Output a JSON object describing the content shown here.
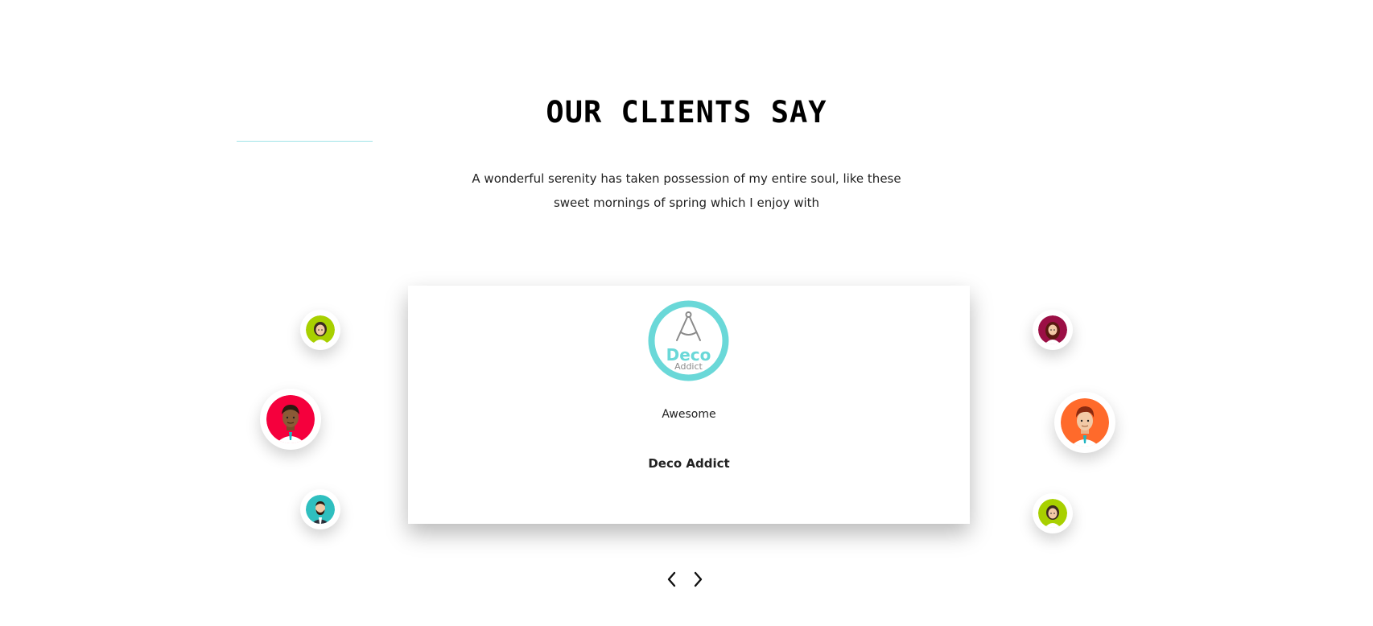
{
  "section": {
    "title": "OUR CLIENTS SAY",
    "subtitle_line1": "A wonderful serenity has taken possession of my entire soul, like these",
    "subtitle_line2": "sweet mornings of spring which I enjoy with"
  },
  "testimonial": {
    "logo": {
      "icon": "compass-logo-icon",
      "brand_line1": "Deco",
      "brand_line2": "Addict",
      "color": "#6ad8d8"
    },
    "quote": "Awesome",
    "client_name": "Deco Addict"
  },
  "avatars": [
    {
      "icon": "woman-avatar-icon",
      "bg": "#a8d000",
      "side": "left",
      "size": "small"
    },
    {
      "icon": "man-avatar-icon",
      "bg": "#f5003d",
      "side": "left",
      "size": "large"
    },
    {
      "icon": "bearded-man-avatar-icon",
      "bg": "#2fbfbf",
      "side": "left",
      "size": "small"
    },
    {
      "icon": "woman-avatar-icon",
      "bg": "#9b0f45",
      "side": "right",
      "size": "small"
    },
    {
      "icon": "man-avatar-icon",
      "bg": "#ff6a2b",
      "side": "right",
      "size": "large"
    },
    {
      "icon": "woman-avatar-icon",
      "bg": "#a8d000",
      "side": "right",
      "size": "small"
    }
  ],
  "navigation": {
    "prev_icon": "chevron-left-icon",
    "next_icon": "chevron-right-icon"
  },
  "colors": {
    "accent": "#6ad8d8",
    "underline": "#9fe3e8"
  }
}
